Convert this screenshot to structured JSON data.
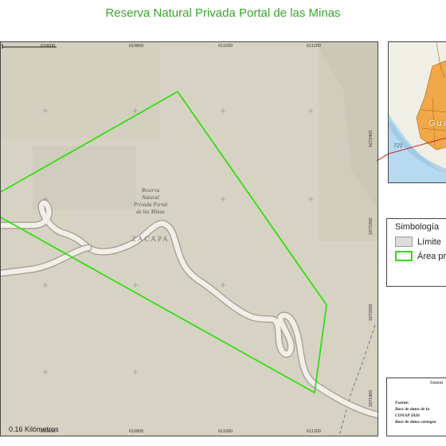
{
  "title": "Reserva Natural Privada Portal de las Minas",
  "map": {
    "x_ticks": [
      "610600",
      "610800",
      "611000",
      "611200"
    ],
    "y_ticks": [
      "1672400",
      "1672200",
      "1672000",
      "1671800"
    ],
    "place_label": [
      "Reserva",
      "Natural",
      "Privada Portal",
      "de las Minas"
    ],
    "region_label": "ZACAPA",
    "colors": {
      "boundary": "#33dd11",
      "road": "#f2efe9",
      "terrain": "#d7d3c4"
    }
  },
  "inset": {
    "country_label": "Guate",
    "route_label": "721"
  },
  "legend": {
    "title": "Simbología",
    "items": [
      {
        "label": "Límite",
        "color": "#dddddd"
      },
      {
        "label": "Área pr",
        "color": "#33dd11"
      }
    ]
  },
  "info": {
    "system_label": "Sistem",
    "source_heading": "Fuente:",
    "line1": "Base de datos de la",
    "line2": "CONAP 2026",
    "line3": "Base de datos cartogra"
  },
  "scale": {
    "label": "0.16 Kilómetros"
  }
}
